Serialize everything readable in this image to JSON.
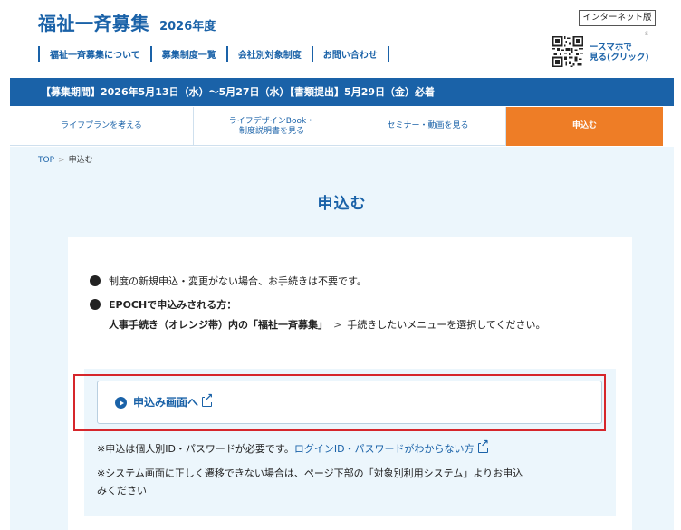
{
  "header": {
    "title": "福祉一斉募集",
    "year": "2026年度",
    "badge": "インターネット版",
    "tiny_mark": "s",
    "qr_label_line1": "ースマホで",
    "qr_label_line2": "見る(クリック)",
    "nav": [
      {
        "label": "福祉一斉募集について"
      },
      {
        "label": "募集制度一覧"
      },
      {
        "label": "会社別対象制度"
      },
      {
        "label": "お問い合わせ"
      }
    ]
  },
  "period_banner": "【募集期間】2026年5月13日（水）〜5月27日（水）【書類提出】5月29日（金）必着",
  "tabs": [
    {
      "line1": "ライフプランを考える",
      "line2": ""
    },
    {
      "line1": "ライフデザインBook・",
      "line2": "制度説明書を見る"
    },
    {
      "line1": "セミナー・動画を見る",
      "line2": ""
    },
    {
      "line1": "申込む",
      "line2": ""
    }
  ],
  "breadcrumb": {
    "home": "TOP",
    "sep": ">",
    "current": "申込む"
  },
  "page_title": "申込む",
  "bullets": {
    "item1": "制度の新規申込・変更がない場合、お手続きは不要です。",
    "item2": "EPOCHで申込みされる方：",
    "sub_prefix": "人事手続き（オレンジ帯）内の「福祉一斉募集」",
    "sub_gt": ">",
    "sub_suffix": "手続きしたいメニューを選択してください。"
  },
  "apply": {
    "label": "申込み画面へ",
    "note1_prefix": "※申込は個人別ID・パスワードが必要です。",
    "note1_link": "ログインID・パスワードがわからない方",
    "note2_line1": "※システム画面に正しく遷移できない場合は、ページ下部の「対象別利用システム」よりお申込",
    "note2_line2": "みください"
  },
  "colors": {
    "brand_blue": "#1a62a8",
    "accent_orange": "#ee7d26",
    "highlight_red": "#d6262b",
    "panel_bg": "#ecf6fc"
  },
  "icons": [
    "qr-code-icon",
    "play-circle-icon",
    "external-link-icon",
    "bullet-dot-icon"
  ]
}
